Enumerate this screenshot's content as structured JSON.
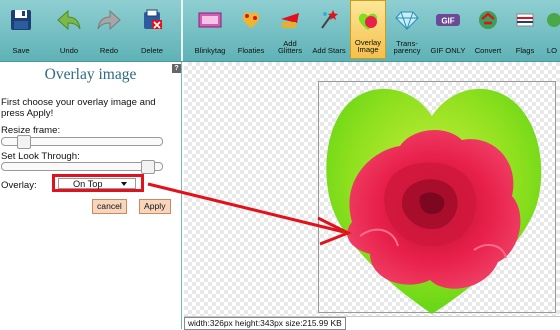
{
  "toolbar": {
    "file_buttons": [
      {
        "label": "Save",
        "icon": "floppy-disk-icon"
      },
      {
        "label": "Undo",
        "icon": "undo-arrow-icon"
      },
      {
        "label": "Redo",
        "icon": "redo-arrow-icon"
      },
      {
        "label": "Delete",
        "icon": "delete-icon"
      }
    ],
    "tool_buttons": [
      {
        "label": "Blinkytag",
        "icon": "blinkytag-icon"
      },
      {
        "label": "Floaties",
        "icon": "floaties-icon"
      },
      {
        "label": "Add\nGlitters",
        "icon": "glitter-icon"
      },
      {
        "label": "Add Stars",
        "icon": "stars-icon"
      },
      {
        "label": "Overlay\nImage",
        "icon": "overlay-image-icon",
        "active": true
      },
      {
        "label": "Trans-\nparency",
        "icon": "diamond-icon"
      },
      {
        "label": "GIF ONLY",
        "icon": "gif-icon"
      },
      {
        "label": "Convert",
        "icon": "convert-icon"
      },
      {
        "label": "Flags",
        "icon": "flag-icon"
      },
      {
        "label": "LO",
        "icon": "logo-icon"
      }
    ],
    "gif_icon_text": "GIF"
  },
  "panel": {
    "title": "Overlay image",
    "help_glyph": "?",
    "instructions": "First choose your overlay image and press Apply!",
    "resize_label": "Resize frame:",
    "look_through_label": "Set Look Through:",
    "overlay_label": "Overlay:",
    "overlay_value": "On Top",
    "resize_level": 0.1,
    "look_through_level": 0.95,
    "cancel_label": "cancel",
    "apply_label": "Apply"
  },
  "status": {
    "text": "width:326px  height:343px  size:215.99 KB"
  },
  "colors": {
    "toolbar": "#6bbcc0",
    "highlight": "#e0121b",
    "arrow": "#e0121b",
    "heart": "#7ee01c",
    "rose": "#e8204a"
  }
}
